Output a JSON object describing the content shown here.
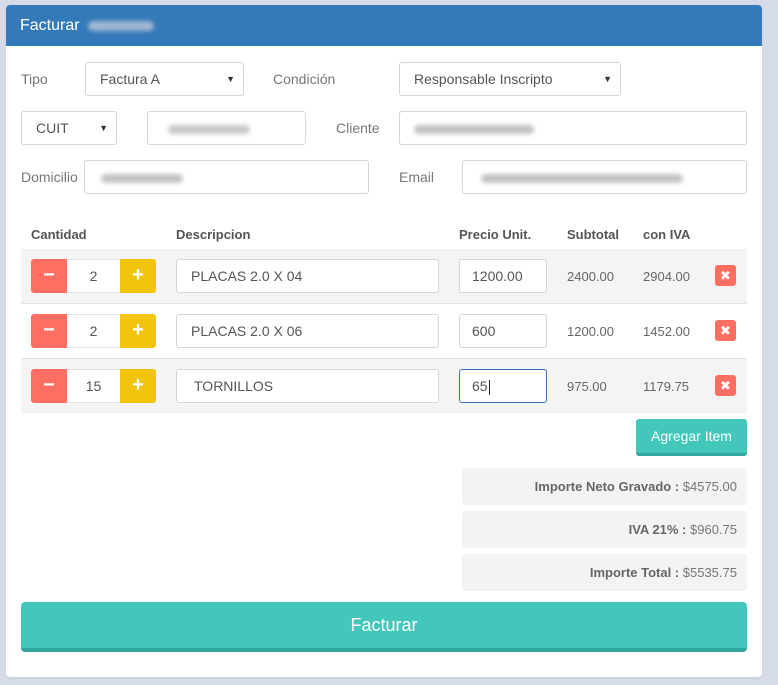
{
  "header": {
    "title": "Facturar"
  },
  "form": {
    "tipo_label": "Tipo",
    "tipo_value": "Factura A",
    "condicion_label": "Condición",
    "condicion_value": "Responsable Inscripto",
    "doc_type_value": "CUIT",
    "cliente_label": "Cliente",
    "domicilio_label": "Domicilio",
    "email_label": "Email"
  },
  "table": {
    "headers": [
      "Cantidad",
      "Descripcion",
      "Precio Unit.",
      "Subtotal",
      "con IVA"
    ],
    "rows": [
      {
        "qty": "2",
        "descripcion": "PLACAS 2.0 X 04",
        "precio": "1200.00",
        "subtotal": "2400.00",
        "con_iva": "2904.00"
      },
      {
        "qty": "2",
        "descripcion": "PLACAS 2.0 X 06",
        "precio": "600",
        "subtotal": "1200.00",
        "con_iva": "1452.00"
      },
      {
        "qty": "15",
        "descripcion": "TORNILLOS",
        "precio": "65",
        "subtotal": "975.00",
        "con_iva": "1179.75"
      }
    ],
    "minus_symbol": "−",
    "plus_symbol": "+",
    "delete_symbol": "✖"
  },
  "actions": {
    "agregar_label": "Agregar Item",
    "facturar_label": "Facturar"
  },
  "totals": {
    "neto_label": "Importe Neto Gravado :",
    "neto_value": "$4575.00",
    "iva_label": "IVA 21% :",
    "iva_value": "$960.75",
    "total_label": "Importe Total :",
    "total_value": "$5535.75"
  },
  "colors": {
    "header": "#347ab8",
    "teal": "#43c7bb",
    "minus": "#ff6e62",
    "plus": "#f2c40d"
  },
  "icons": {
    "select_caret": "caret-down-icon",
    "delete": "times-icon"
  }
}
